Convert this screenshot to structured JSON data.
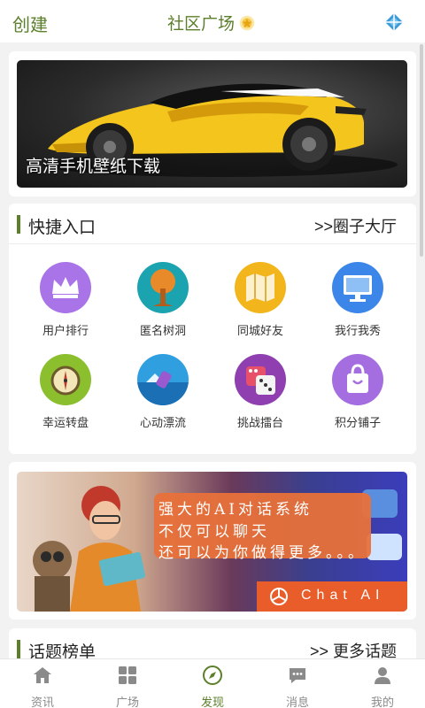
{
  "header": {
    "create_label": "创建",
    "title": "社区广场"
  },
  "banner_top": {
    "caption": "高清手机壁纸下载"
  },
  "quick_entry": {
    "title": "快捷入口",
    "link": ">>圈子大厅",
    "items": [
      {
        "label": "用户排行",
        "icon": "crown-icon",
        "color": "#a874e8"
      },
      {
        "label": "匿名树洞",
        "icon": "tree-icon",
        "color": "#1ba3b0"
      },
      {
        "label": "同城好友",
        "icon": "map-icon",
        "color": "#f2b51c"
      },
      {
        "label": "我行我秀",
        "icon": "monitor-icon",
        "color": "#3b86e8"
      },
      {
        "label": "幸运转盘",
        "icon": "compass-icon",
        "color": "#8cbf2e"
      },
      {
        "label": "心动漂流",
        "icon": "bottle-icon",
        "color": "#2f9fe0"
      },
      {
        "label": "挑战擂台",
        "icon": "dice-icon",
        "color": "#8f3fb0"
      },
      {
        "label": "积分铺子",
        "icon": "bag-icon",
        "color": "#a46de0"
      }
    ]
  },
  "banner_ai": {
    "lines": [
      "强大的AI对话系统",
      "不仅可以聊天",
      "还可以为你做得更多。。。"
    ],
    "button": "Chat AI"
  },
  "topic_section": {
    "title": "话题榜单",
    "link": ">> 更多话题"
  },
  "tabbar": {
    "active": "发现",
    "tabs": [
      {
        "label": "资讯",
        "icon": "home-icon"
      },
      {
        "label": "广场",
        "icon": "grid-icon"
      },
      {
        "label": "发现",
        "icon": "compass-icon"
      },
      {
        "label": "消息",
        "icon": "message-icon"
      },
      {
        "label": "我的",
        "icon": "user-icon"
      }
    ]
  },
  "colors": {
    "accent": "#5b7f2b",
    "background": "#f2f2f2"
  }
}
